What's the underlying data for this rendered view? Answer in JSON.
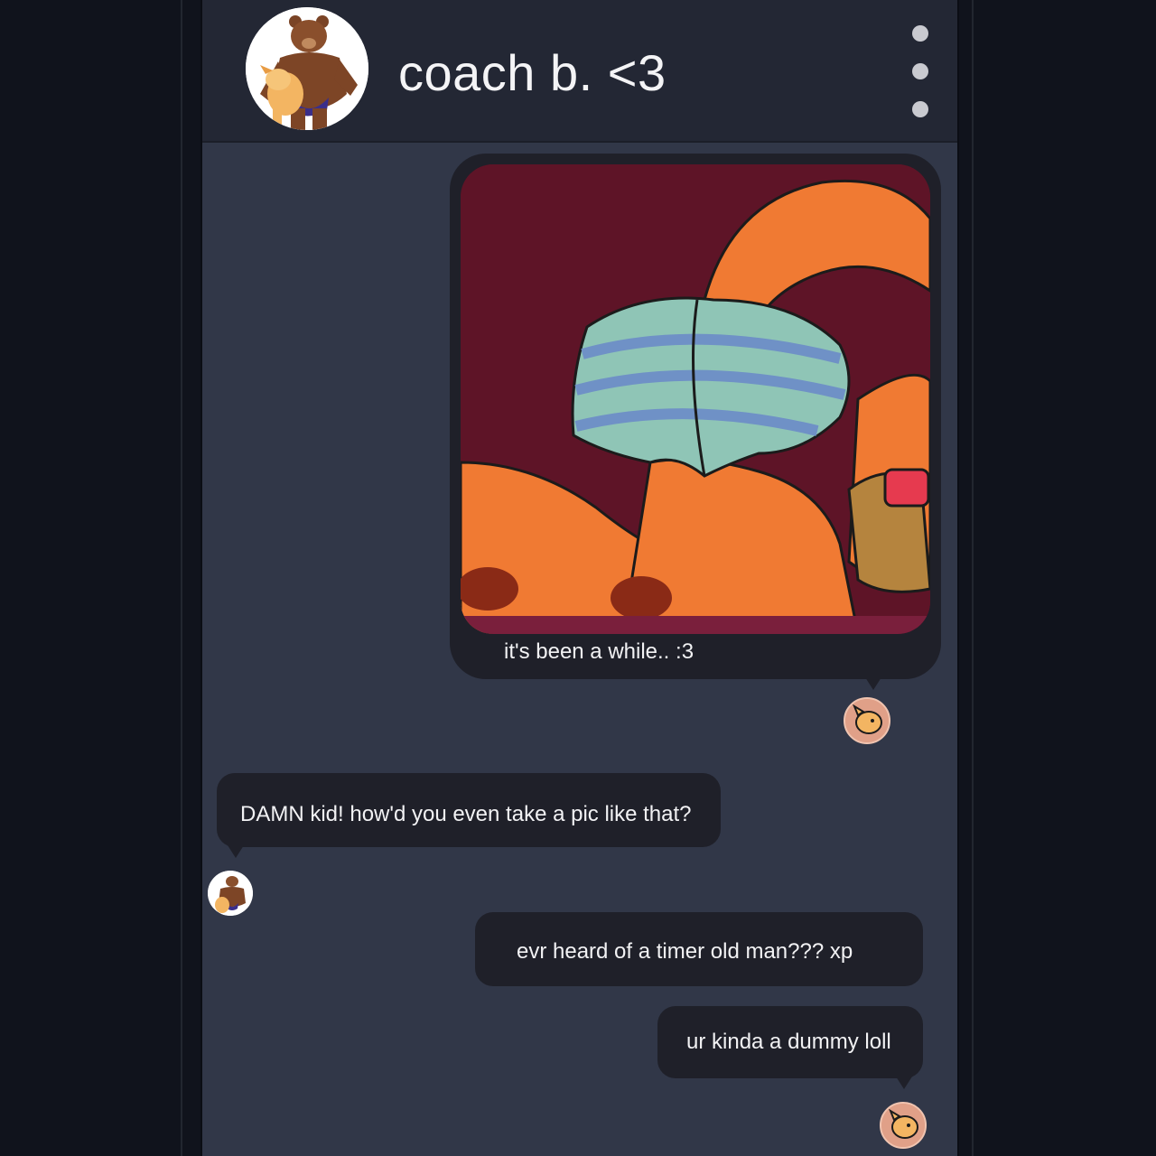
{
  "header": {
    "contact_name": "coach b. <3",
    "menu_icon": "kebab-menu-icon",
    "avatar": "bear-contact-avatar"
  },
  "messages": [
    {
      "sender": "me",
      "type": "image",
      "image": "fox-photo",
      "caption": "it's been a while.. :3"
    },
    {
      "sender": "them",
      "type": "text",
      "text": "DAMN kid! how'd you even take a pic like that?"
    },
    {
      "sender": "me",
      "type": "text",
      "text": "evr heard of a timer old man??? xp"
    },
    {
      "sender": "me",
      "type": "text",
      "text": "ur kinda a dummy loll"
    }
  ],
  "colors": {
    "background": "#10131c",
    "phone": "#313748",
    "header": "#232734",
    "bubble": "#1f2029",
    "text": "#f2f2f4"
  }
}
